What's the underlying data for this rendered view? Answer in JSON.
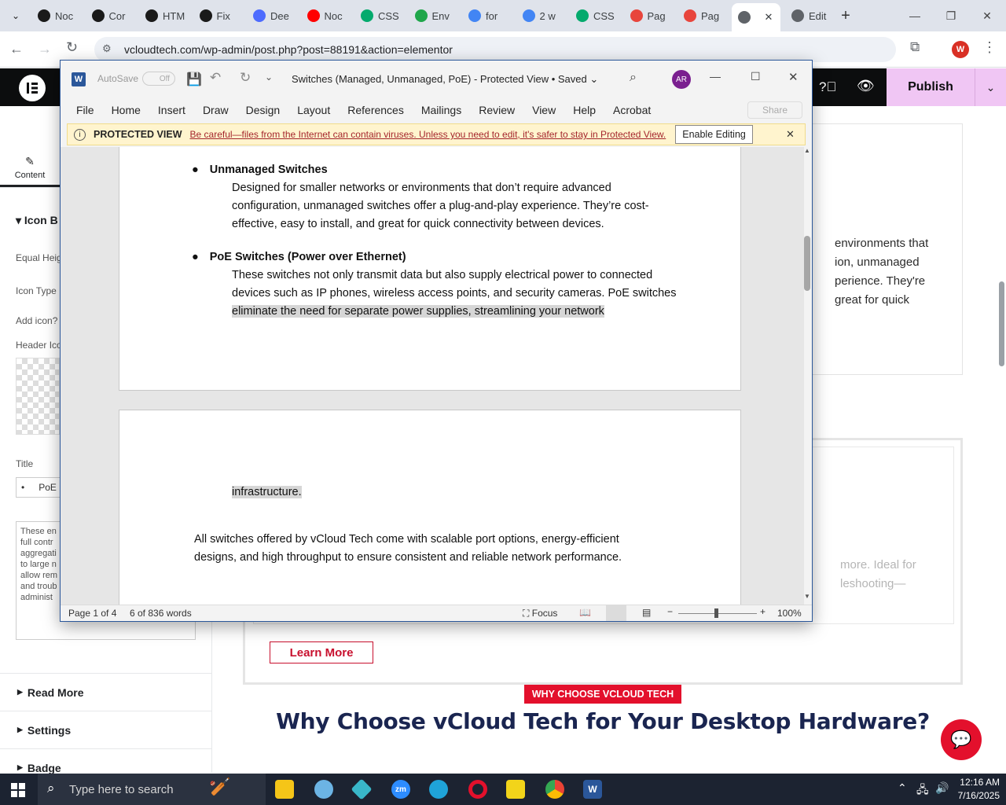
{
  "browser": {
    "tabs": [
      {
        "label": "Noc",
        "icon": "openai-icon",
        "color": "#1a1a1a"
      },
      {
        "label": "Cor",
        "icon": "openai-icon",
        "color": "#1a1a1a"
      },
      {
        "label": "HTM",
        "icon": "openai-icon",
        "color": "#1a1a1a"
      },
      {
        "label": "Fix",
        "icon": "openai-icon",
        "color": "#1a1a1a"
      },
      {
        "label": "Dee",
        "icon": "deepseek-icon",
        "color": "#4d6bfe"
      },
      {
        "label": "Noc",
        "icon": "youtube-icon",
        "color": "#ff0000"
      },
      {
        "label": "CSS",
        "icon": "w3schools-icon",
        "color": "#04aa6d"
      },
      {
        "label": "Env",
        "icon": "envato-icon",
        "color": "#1fa64a"
      },
      {
        "label": "for",
        "icon": "google-icon",
        "color": "#4285f4"
      },
      {
        "label": "2 w",
        "icon": "google-icon",
        "color": "#4285f4"
      },
      {
        "label": "CSS",
        "icon": "w3schools-icon",
        "color": "#04aa6d"
      },
      {
        "label": "Pag",
        "icon": "pagespeed-icon",
        "color": "#e8453c"
      },
      {
        "label": "Pag",
        "icon": "pagespeed-icon",
        "color": "#e8453c"
      },
      {
        "label": "",
        "icon": "globe-icon",
        "color": "#5f6368",
        "active": true
      },
      {
        "label": "Edit",
        "icon": "globe-icon",
        "color": "#5f6368"
      }
    ],
    "url": "vcloudtech.com/wp-admin/post.php?post=88191&action=elementor",
    "profile_initial": "W"
  },
  "elementor": {
    "publish_label": "Publish",
    "tab_content": "Content",
    "section_icon_box": "Icon B",
    "labels": {
      "equal_height": "Equal Heig",
      "icon_type": "Icon Type",
      "add_icon": "Add icon?",
      "header_icon": "Header Ico",
      "title": "Title"
    },
    "title_value": "PoE",
    "description_lines": [
      "These en",
      "full contr",
      "aggregati",
      "to large n",
      "allow rem",
      "and troub",
      "administ"
    ],
    "sections": [
      "Read More",
      "Settings",
      "Badge"
    ]
  },
  "preview": {
    "card_lines": [
      "environments that",
      "ion, unmanaged",
      "perience. They're",
      "great for quick"
    ],
    "card2_lines": [
      "more. Ideal for",
      "leshooting—"
    ],
    "learn_more": "Learn More",
    "badge": "WHY CHOOSE VCLOUD TECH",
    "heading": "Why Choose vCloud Tech for Your Desktop Hardware?"
  },
  "word": {
    "autosave": "AutoSave",
    "autosave_state": "Off",
    "title": "Switches (Managed, Unmanaged, PoE)  -  Protected View • Saved",
    "avatar": "AR",
    "menu": [
      "File",
      "Home",
      "Insert",
      "Draw",
      "Design",
      "Layout",
      "References",
      "Mailings",
      "Review",
      "View",
      "Help",
      "Acrobat"
    ],
    "share": "Share",
    "protected_label": "PROTECTED VIEW",
    "protected_message": "Be careful—files from the Internet can contain viruses. Unless you need to edit, it's safer to stay in Protected View.",
    "enable_editing": "Enable Editing",
    "doc": {
      "b1_title": "Unmanaged Switches",
      "b1_lines": [
        " Designed for smaller networks or environments that don’t require advanced",
        "configuration, unmanaged switches offer a plug-and-play experience. They’re cost-",
        "effective, easy to install, and great for quick connectivity between devices."
      ],
      "b2_title": "PoE Switches (Power over Ethernet)",
      "b2_lines": [
        " These switches not only transmit data but also supply electrical power to connected",
        "devices such as IP phones, wireless access points, and security cameras. PoE switches",
        "eliminate the need for separate power supplies, streamlining your network"
      ],
      "p2_hl": "infrastructure.",
      "p2_lines": [
        "All switches offered by vCloud Tech come with scalable port options, energy-efficient",
        "designs, and high throughput to ensure consistent and reliable network performance."
      ]
    },
    "status": {
      "page": "Page 1 of 4",
      "words": "6 of 836 words",
      "focus": "Focus",
      "zoom": "100%"
    }
  },
  "taskbar": {
    "search_placeholder": "Type here to search",
    "time": "12:16 AM",
    "date": "7/16/2025"
  }
}
